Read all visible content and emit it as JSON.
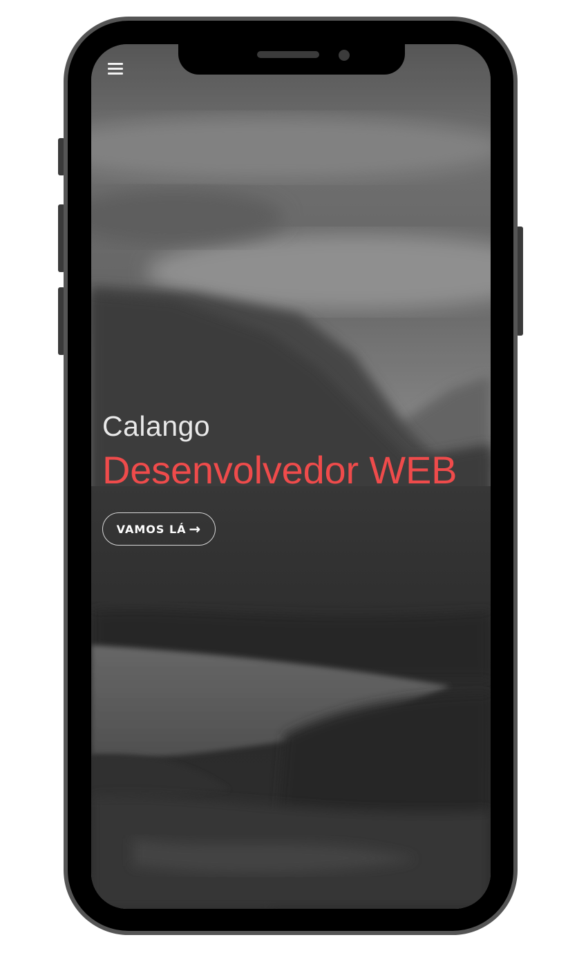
{
  "hero": {
    "name": "Calango",
    "role": "Desenvolvedor WEB",
    "cta_label": "VAMOS LÁ",
    "cta_arrow": "→"
  },
  "icons": {
    "menu": "hamburger-menu-icon",
    "cta_arrow": "arrow-right-icon"
  },
  "colors": {
    "accent": "#ef4b4b",
    "text_light": "#e9e9e9",
    "frame": "#555555",
    "bezel": "#000000"
  }
}
